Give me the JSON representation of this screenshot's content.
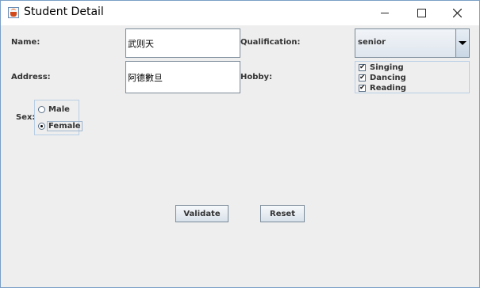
{
  "window": {
    "title": "Student Detail"
  },
  "form": {
    "name_label": "Name:",
    "name_value": "武则天",
    "address_label": "Address:",
    "address_value": "阿德數旦",
    "qualification_label": "Qualification:",
    "qualification_value": "senior",
    "hobby_label": "Hobby:",
    "hobbies": [
      {
        "label": "Singing",
        "checked": true
      },
      {
        "label": "Dancing",
        "checked": true
      },
      {
        "label": "Reading",
        "checked": true
      }
    ],
    "sex_label": "Sex:",
    "sex_options": [
      {
        "label": "Male",
        "selected": false
      },
      {
        "label": "Female",
        "selected": true
      }
    ]
  },
  "buttons": {
    "validate": "Validate",
    "reset": "Reset"
  },
  "icons": {
    "app": "java-cup-icon",
    "minimize": "minimize-icon",
    "maximize": "maximize-icon",
    "close": "close-icon",
    "dropdown": "chevron-down-icon",
    "check": "checkmark-icon"
  }
}
